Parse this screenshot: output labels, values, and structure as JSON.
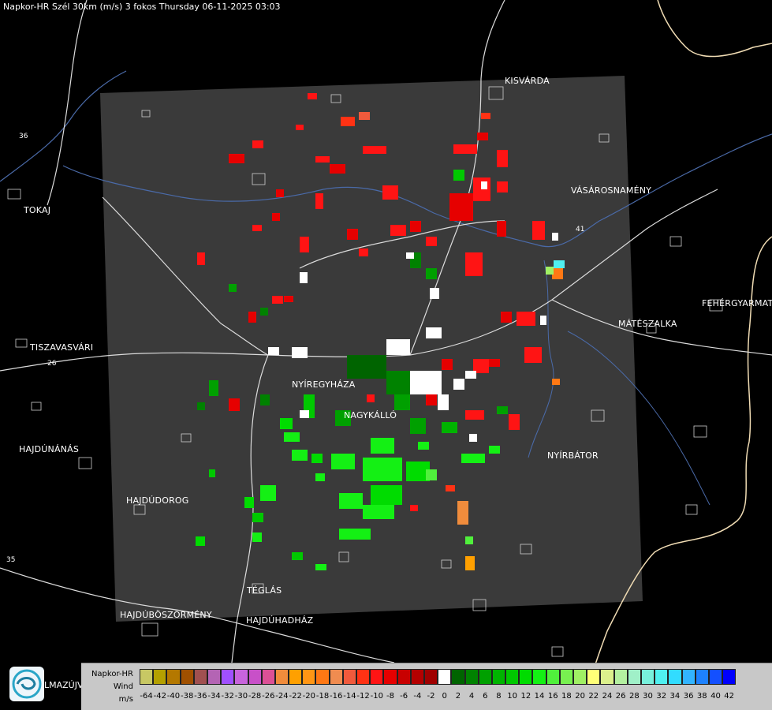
{
  "title": "Napkor-HR Szél 30km (m/s) 3 fokos Thursday 06-11-2025 03:03",
  "cities": [
    {
      "name": "KISVÁRDA",
      "id": "kisvarda"
    },
    {
      "name": "VÁSÁROSNAMÉNY",
      "id": "vasarosnameny"
    },
    {
      "name": "TOKAJ",
      "id": "tokaj"
    },
    {
      "name": "FEHÉRGYARMAT",
      "id": "fehergyarmat"
    },
    {
      "name": "MÁTÉSZALKA",
      "id": "mateszalka"
    },
    {
      "name": "TISZAVASVÁRI",
      "id": "tiszavasvari"
    },
    {
      "name": "NYÍREGYHÁZA",
      "id": "nyiregyhaza"
    },
    {
      "name": "NAGYKÁLLÓ",
      "id": "nagykallo"
    },
    {
      "name": "NYÍRBÁTOR",
      "id": "nyirbator"
    },
    {
      "name": "HAJDÚNÁNÁS",
      "id": "hajdunanas"
    },
    {
      "name": "HAJDÚDOROG",
      "id": "hajdudorog"
    },
    {
      "name": "TÉGLÁS",
      "id": "teglas"
    },
    {
      "name": "HAJDÚBÖSZÖRMÉNY",
      "id": "hajduboszormeny"
    },
    {
      "name": "HAJDÚHADHÁZ",
      "id": "hajduhadhaz"
    }
  ],
  "road_numbers": [
    "36",
    "26",
    "41",
    "35"
  ],
  "logo_text": "LMAZÚJVÁR",
  "legend": {
    "label_line1": "Napkor-HR",
    "label_line2": "Wind",
    "label_line3": "m/s",
    "ticks": [
      "-64",
      "-42",
      "-40",
      "-38",
      "-36",
      "-34",
      "-32",
      "-30",
      "-28",
      "-26",
      "-24",
      "-22",
      "-20",
      "-18",
      "-16",
      "-14",
      "-12",
      "-10",
      "-8",
      "-6",
      "-4",
      "-2",
      "0",
      "2",
      "4",
      "6",
      "8",
      "10",
      "12",
      "14",
      "16",
      "18",
      "20",
      "22",
      "24",
      "26",
      "28",
      "30",
      "32",
      "34",
      "36",
      "38",
      "40",
      "42"
    ],
    "colors": [
      "#c8c864",
      "#b4a000",
      "#b47800",
      "#a05000",
      "#a05050",
      "#b464b4",
      "#a050ff",
      "#c864dc",
      "#c850c8",
      "#dc5096",
      "#f08c3c",
      "#ffa000",
      "#ff9614",
      "#ff7814",
      "#f08c50",
      "#f05a3c",
      "#ff3214",
      "#ff1414",
      "#e60000",
      "#c80000",
      "#b40000",
      "#a00000",
      "#ffffff",
      "#006400",
      "#008200",
      "#00a000",
      "#00b400",
      "#00c800",
      "#00dc00",
      "#14f014",
      "#50f03c",
      "#78f050",
      "#a0f064",
      "#ffff78",
      "#dcf08c",
      "#b4f0a0",
      "#a0f0c8",
      "#78f0dc",
      "#50f0f0",
      "#32dcff",
      "#32b4ff",
      "#1e82ff",
      "#1450ff",
      "#0000ff"
    ]
  }
}
